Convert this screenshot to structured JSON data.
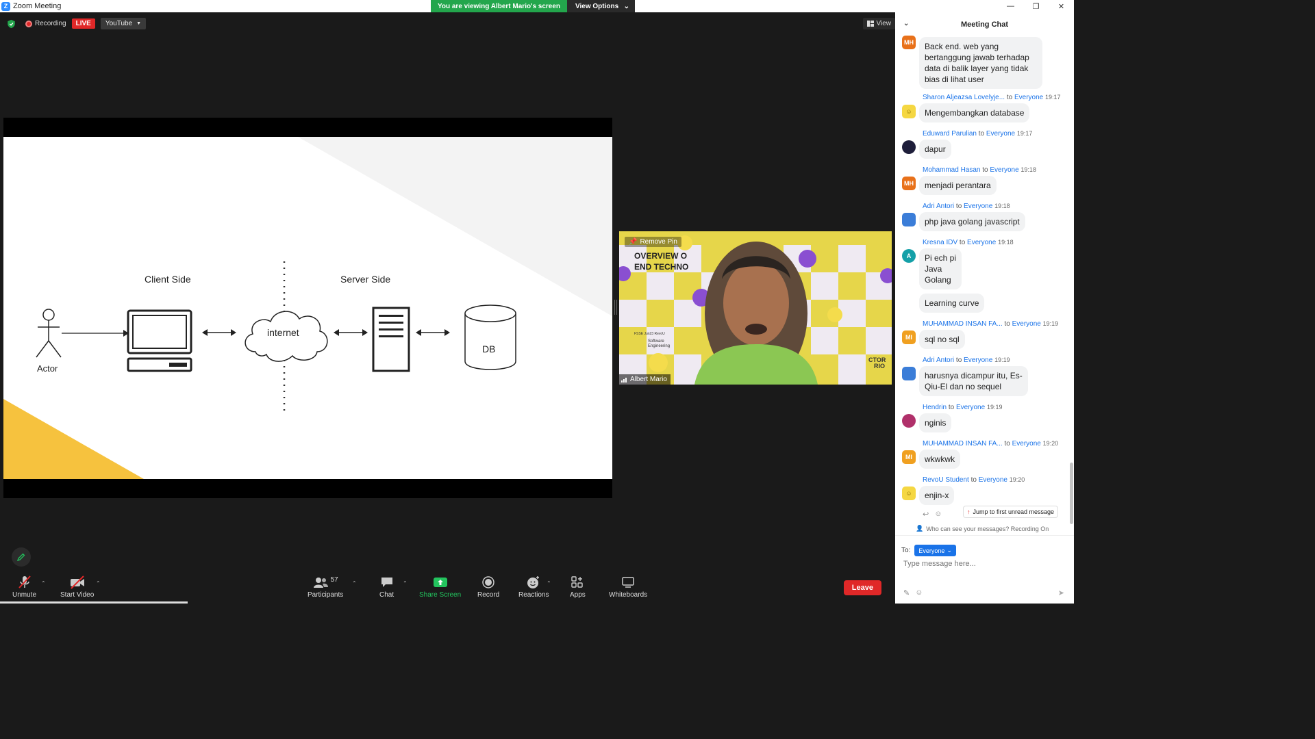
{
  "window": {
    "title": "Zoom Meeting",
    "controls": [
      "—",
      "❐",
      "✕"
    ]
  },
  "banner": {
    "viewing": "You are viewing Albert Mario's screen",
    "options": "View Options"
  },
  "topbar": {
    "recording": "Recording",
    "live": "LIVE",
    "stream": "YouTube",
    "view": "View"
  },
  "slide": {
    "client_side": "Client Side",
    "server_side": "Server Side",
    "actor": "Actor",
    "internet": "internet",
    "db": "DB"
  },
  "video": {
    "remove_pin": "Remove Pin",
    "name": "Albert Mario",
    "bg_text_1": "OVERVIEW O",
    "bg_text_2": "END TECHNO",
    "bg_small_1": "FSSE Jun23 RevoU",
    "bg_small_2": "Software",
    "bg_small_3": "Engineering",
    "bg_right_1": "CTOR",
    "bg_right_2": "RIO"
  },
  "toolbar": {
    "unmute": "Unmute",
    "start_video": "Start Video",
    "participants": "Participants",
    "participants_count": "57",
    "chat": "Chat",
    "share_screen": "Share Screen",
    "record": "Record",
    "reactions": "Reactions",
    "apps": "Apps",
    "whiteboards": "Whiteboards",
    "leave": "Leave"
  },
  "chat": {
    "title": "Meeting Chat",
    "messages": [
      {
        "sender": "",
        "to": "",
        "time": "",
        "avatar": "MH",
        "avatar_color": "#e8711a",
        "text": [
          "Back end. web yang",
          "bertanggung jawab terhadap",
          "data di balik layer yang tidak",
          "bias di lihat user"
        ]
      },
      {
        "sender": "Sharon Aljeazsa Lovelyje...",
        "to": "to",
        "audience": "Everyone",
        "time": "19:17",
        "avatar": "☺",
        "avatar_color": "#f5d742",
        "text": [
          "Mengembangkan database"
        ]
      },
      {
        "sender": "Eduward Parulian",
        "to": "to",
        "audience": "Everyone",
        "time": "19:17",
        "avatar": "",
        "avatar_color": "#1e1e3a",
        "text": [
          "dapur"
        ]
      },
      {
        "sender": "Mohammad Hasan",
        "to": "to",
        "audience": "Everyone",
        "time": "19:18",
        "avatar": "MH",
        "avatar_color": "#e8711a",
        "text": [
          "menjadi perantara"
        ]
      },
      {
        "sender": "Adri Antori",
        "to": "to",
        "audience": "Everyone",
        "time": "19:18",
        "avatar": "",
        "avatar_color": "#3b7dd8",
        "text": [
          "php java golang javascript"
        ]
      },
      {
        "sender": "Kresna IDV",
        "to": "to",
        "audience": "Everyone",
        "time": "19:18",
        "avatar": "A",
        "avatar_color": "#14a0a8",
        "text": [
          "Pi ech pi",
          "Java",
          "Golang"
        ],
        "extra": "Learning curve"
      },
      {
        "sender": "MUHAMMAD INSAN FA...",
        "to": "to",
        "audience": "Everyone",
        "time": "19:19",
        "avatar": "MI",
        "avatar_color": "#f0a020",
        "text": [
          "sql no sql"
        ]
      },
      {
        "sender": "Adri Antori",
        "to": "to",
        "audience": "Everyone",
        "time": "19:19",
        "avatar": "",
        "avatar_color": "#3b7dd8",
        "text": [
          "harusnya dicampur itu, Es-",
          "Qiu-El dan no sequel"
        ]
      },
      {
        "sender": "Hendrin",
        "to": "to",
        "audience": "Everyone",
        "time": "19:19",
        "avatar": "",
        "avatar_color": "#b0306a",
        "text": [
          "nginis"
        ]
      },
      {
        "sender": "MUHAMMAD INSAN FA...",
        "to": "to",
        "audience": "Everyone",
        "time": "19:20",
        "avatar": "MI",
        "avatar_color": "#f0a020",
        "text": [
          "wkwkwk"
        ]
      },
      {
        "sender": "RevoU Student",
        "to": "to",
        "audience": "Everyone",
        "time": "19:20",
        "avatar": "☺",
        "avatar_color": "#f5d742",
        "text": [
          "enjin-x"
        ]
      }
    ],
    "jump": "Jump to first unread message",
    "who_can_see": "Who can see your messages? Recording On",
    "to_label": "To:",
    "to_value": "Everyone",
    "input_placeholder": "Type message here..."
  },
  "colors": {
    "accent": "#1a73e8",
    "live_red": "#e02828",
    "banner_green": "#23a64c",
    "share_green": "#23c45e"
  }
}
